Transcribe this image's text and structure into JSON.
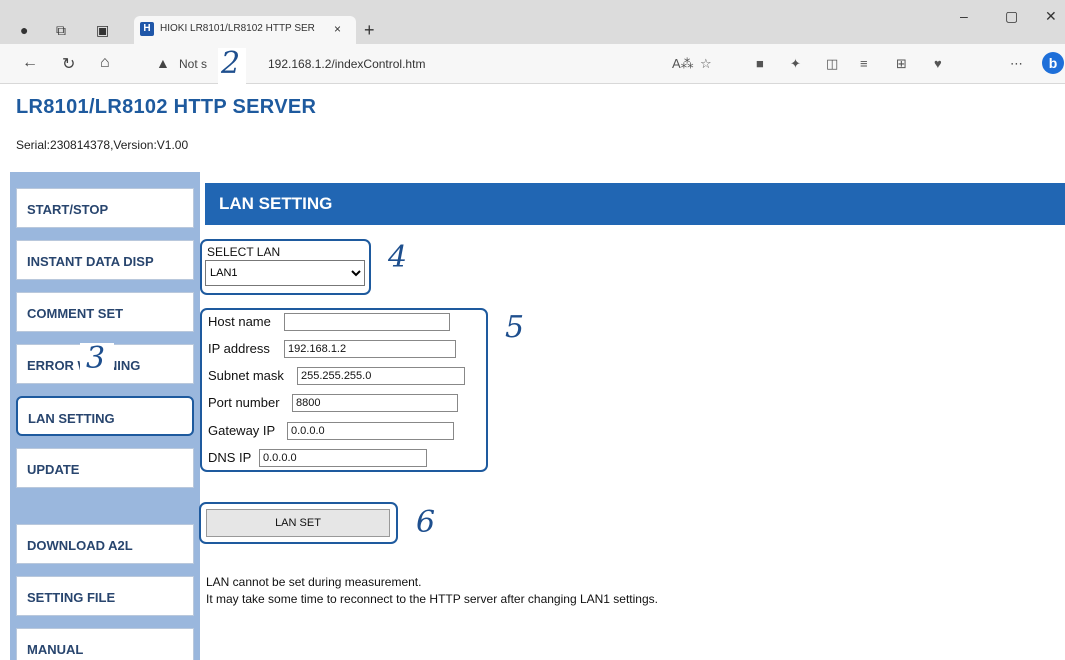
{
  "browser": {
    "tab_title": "HIOKI LR8101/LR8102 HTTP SER",
    "tab_favicon": "H",
    "tab_close": "×",
    "new_tab": "+",
    "window_minimize": "–",
    "window_maximize": "▢",
    "window_close": "✕",
    "not_secure_label": "Not s",
    "url": "192.168.1.2/indexControl.htm",
    "bing_label": "b"
  },
  "page": {
    "title": "LR8101/LR8102 HTTP SERVER",
    "serial": "Serial:230814378,Version:V1.00"
  },
  "sidebar": {
    "items": [
      {
        "label": "START/STOP"
      },
      {
        "label": "INSTANT DATA DISP"
      },
      {
        "label": "COMMENT SET"
      },
      {
        "label": "ERROR WARNING"
      },
      {
        "label": "LAN SETTING"
      },
      {
        "label": "UPDATE"
      },
      {
        "label": "DOWNLOAD A2L"
      },
      {
        "label": "SETTING FILE"
      },
      {
        "label": "MANUAL"
      }
    ]
  },
  "main": {
    "section_title": "LAN SETTING",
    "select_lan": {
      "label": "SELECT LAN",
      "value": "LAN1"
    },
    "fields": {
      "host_name": {
        "label": "Host name",
        "value": ""
      },
      "ip_address": {
        "label": "IP address",
        "value": "192.168.1.2"
      },
      "subnet_mask": {
        "label": "Subnet mask",
        "value": "255.255.255.0"
      },
      "port_number": {
        "label": "Port number",
        "value": "8800"
      },
      "gateway_ip": {
        "label": "Gateway IP",
        "value": "0.0.0.0"
      },
      "dns_ip": {
        "label": "DNS IP",
        "value": "0.0.0.0"
      }
    },
    "lan_set_button": "LAN SET",
    "notes": [
      "LAN cannot be set during measurement.",
      "It may take some time to reconnect to the HTTP server after changing LAN1 settings."
    ]
  },
  "callouts": [
    "2",
    "3",
    "4",
    "5",
    "6"
  ],
  "colors": {
    "accent": "#2166b3",
    "sidebar": "#9ab7dd",
    "title": "#1e5a9e"
  }
}
